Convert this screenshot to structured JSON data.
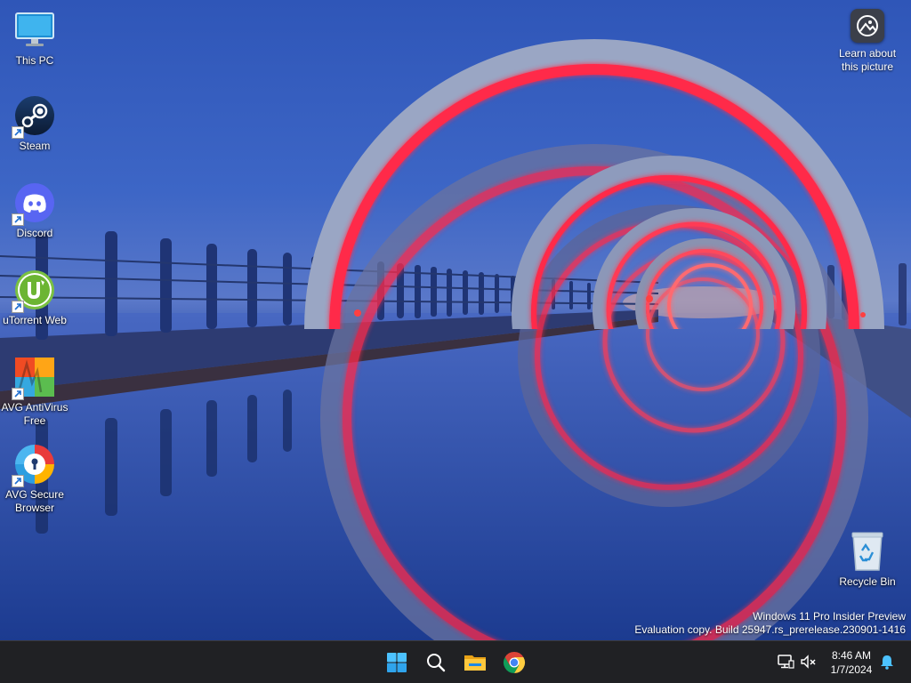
{
  "desktop": {
    "icons": [
      {
        "label": "This PC",
        "icon": "monitor-icon"
      },
      {
        "label": "Steam",
        "icon": "steam-icon"
      },
      {
        "label": "Discord",
        "icon": "discord-icon"
      },
      {
        "label": "uTorrent Web",
        "icon": "utorrent-icon"
      },
      {
        "label": "AVG AntiVirus\nFree",
        "icon": "avg-antivirus-icon"
      },
      {
        "label": "AVG Secure\nBrowser",
        "icon": "avg-browser-icon"
      },
      {
        "label": "Recycle Bin",
        "icon": "recycle-bin-icon"
      }
    ],
    "learn_about_picture": "Learn about\nthis picture",
    "watermark": {
      "line1": "Windows 11 Pro Insider Preview",
      "line2": "Evaluation copy. Build 25947.rs_prerelease.230901-1416"
    }
  },
  "taskbar": {
    "apps": [
      {
        "name": "Start",
        "icon": "windows-logo-icon"
      },
      {
        "name": "Search",
        "icon": "search-icon"
      },
      {
        "name": "File Explorer",
        "icon": "folder-icon"
      },
      {
        "name": "Google Chrome",
        "icon": "chrome-icon"
      }
    ],
    "tray": {
      "time": "8:46 AM",
      "date": "1/7/2024",
      "icons": [
        "network-icon",
        "volume-muted-icon",
        "notification-bell-icon"
      ]
    }
  },
  "colors": {
    "sky": "#2f56b8",
    "ring_glow": "#ff2a4a",
    "ring_concrete": "#9aa6c4",
    "taskbar": "#202124",
    "accent": "#4cc2ff"
  }
}
